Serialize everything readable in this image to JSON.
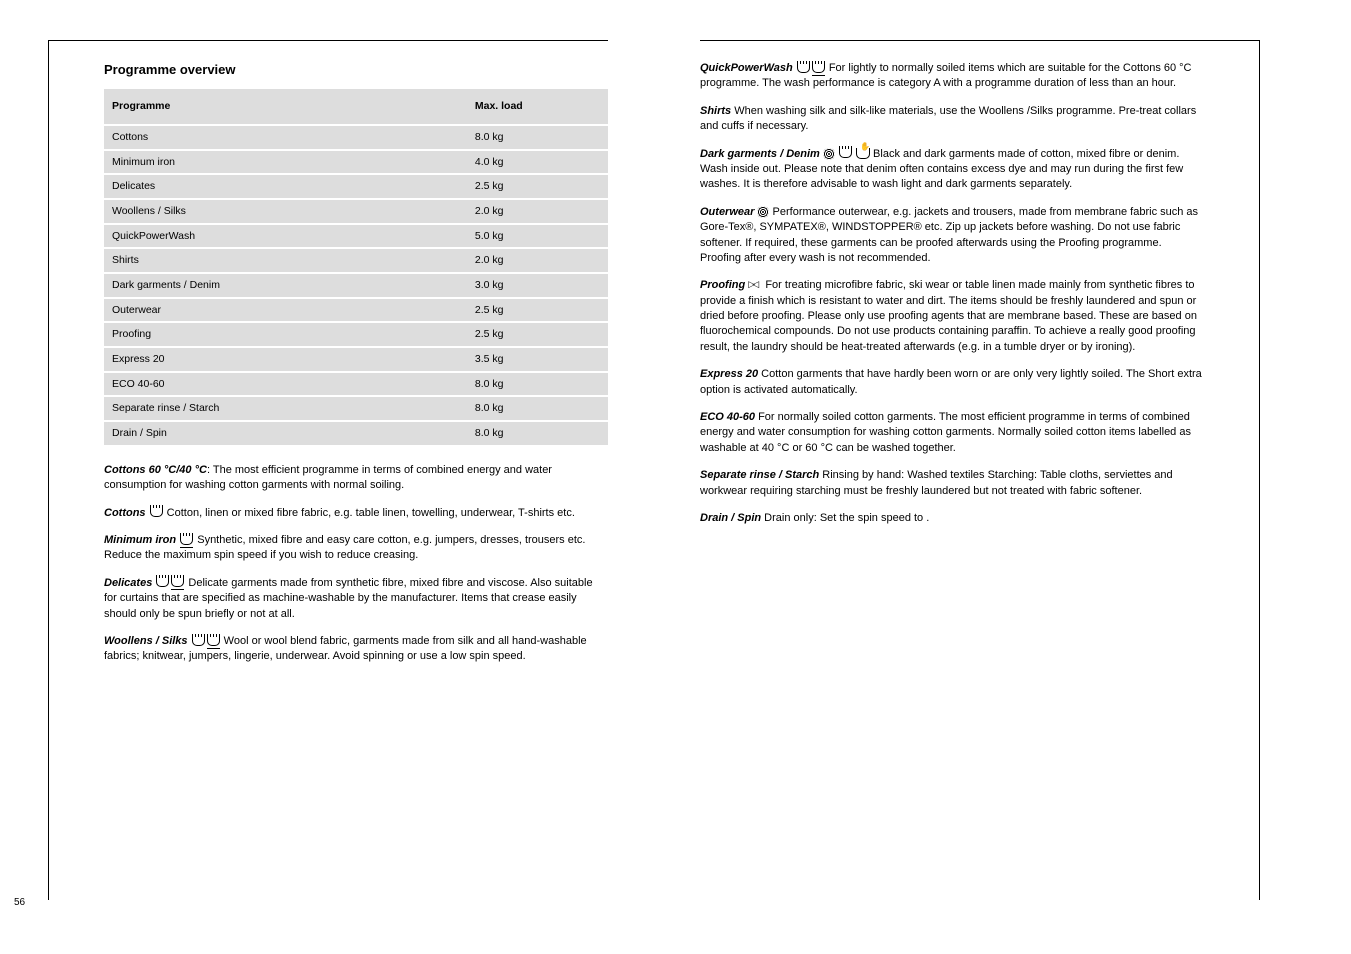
{
  "left": {
    "table_title": "Programme overview",
    "table": {
      "header": [
        "Programme",
        "Max. load"
      ],
      "rows": [
        [
          " Cottons",
          "8.0 kg"
        ],
        [
          "Minimum iron",
          "4.0 kg"
        ],
        [
          "Delicates",
          "2.5 kg"
        ],
        [
          "Woollens   / Silks ",
          "2.0 kg"
        ],
        [
          "QuickPowerWash",
          "5.0 kg"
        ],
        [
          "Shirts",
          "2.0 kg"
        ],
        [
          "Dark garments / Denim",
          "3.0 kg"
        ],
        [
          "Outerwear",
          "2.5 kg"
        ],
        [
          "Proofing",
          "2.5 kg"
        ],
        [
          "Express 20",
          "3.5 kg"
        ],
        [
          "ECO 40-60",
          "8.0 kg"
        ],
        [
          "Separate rinse / Starch",
          "8.0 kg"
        ],
        [
          "Drain / Spin",
          "8.0 kg"
        ]
      ]
    },
    "programs": [
      {
        "title": " Cottons 60 °C/40 °C",
        "desc": ": The most efficient programme in terms of combined energy and water consumption for washing cotton garments with normal soiling."
      },
      {
        "title": " Cottons ",
        "icon_after_title": "tub",
        "desc": " Cotton, linen or mixed fibre fabric, e.g. table linen, towelling, underwear, T-shirts etc."
      },
      {
        "title": "Minimum iron ",
        "icon_after_title": "tub-underline",
        "desc": " Synthetic, mixed fibre and easy care cotton, e.g. jumpers, dresses, trousers etc. Reduce the maximum spin speed if you wish to reduce creasing."
      },
      {
        "title": "Delicates ",
        "icon_after_title": "tub-double",
        "desc": " Delicate garments made from synthetic fibre, mixed fibre and viscose. Also suitable for curtains that are specified as machine-washable by the manufacturer. Items that crease easily should only be spun briefly or not at all."
      },
      {
        "title": "Woollens   / Silks  ",
        "icon_after_title": "tub-double",
        "desc": " Wool or wool blend fabric, garments made from silk and all hand-washable fabrics; knitwear, jumpers, lingerie, underwear. Avoid spinning or use a low spin speed."
      }
    ]
  },
  "right": {
    "programs": [
      {
        "title": "QuickPowerWash ",
        "icon_after_title": "tub-double",
        "desc": " For lightly to normally soiled items which are suitable for the  Cottons 60 °C programme. The wash performance is category A with a programme duration of less than an hour."
      },
      {
        "title": "Shirts",
        "desc": " When washing silk and silk-like materials, use the Woollens /Silks  programme. Pre-treat collars and cuffs if necessary."
      },
      {
        "title": "Dark garments / Denim ",
        "icons_group": "wool-tub-hand",
        "desc": " Black and dark garments made of cotton, mixed fibre or denim. Wash inside out. Please note that denim often contains excess dye and may run during the first few washes. It is therefore advisable to wash light and dark garments separately."
      },
      {
        "title": "Outerwear ",
        "icon_after_title": "wool",
        "desc": " Performance outerwear, e.g. jackets and trousers, made from membrane fabric such as Gore-Tex®, SYMPATEX®, WINDSTOPPER® etc. Zip up jackets before washing. Do not use fabric softener. If required, these garments can be proofed afterwards using the Proofing programme. Proofing after every wash is not recommended."
      },
      {
        "title": "Proofing ",
        "icon_after_title": "bowtie",
        "desc": " For treating microfibre fabric, ski wear or table linen made mainly from synthetic fibres to provide a finish which is resistant to water and dirt. The items should be freshly laundered and spun or dried before proofing. Please only use proofing agents that are membrane based. These are based on fluorochemical compounds. Do not use products containing paraffin. To achieve a really good proofing result, the laundry should be heat-treated afterwards (e.g. in a tumble dryer or by ironing)."
      },
      {
        "title": "Express 20",
        "desc": " Cotton garments that have hardly been worn or are only very lightly soiled. The Short extra option is activated automatically."
      },
      {
        "title": "ECO 40-60",
        "desc": " For normally soiled cotton garments. The most efficient programme in terms of combined energy and water consumption for washing cotton garments. Normally soiled cotton items labelled as washable at 40 °C or 60 °C can be washed together."
      },
      {
        "title": "Separate rinse / Starch",
        "desc": " Rinsing by hand: Washed textiles Starching: Table cloths, serviettes and workwear requiring starching must be freshly laundered but not treated with fabric softener."
      },
      {
        "title": "Drain / Spin",
        "desc": " Drain only: Set the spin speed to ."
      }
    ]
  },
  "page_number": "56"
}
